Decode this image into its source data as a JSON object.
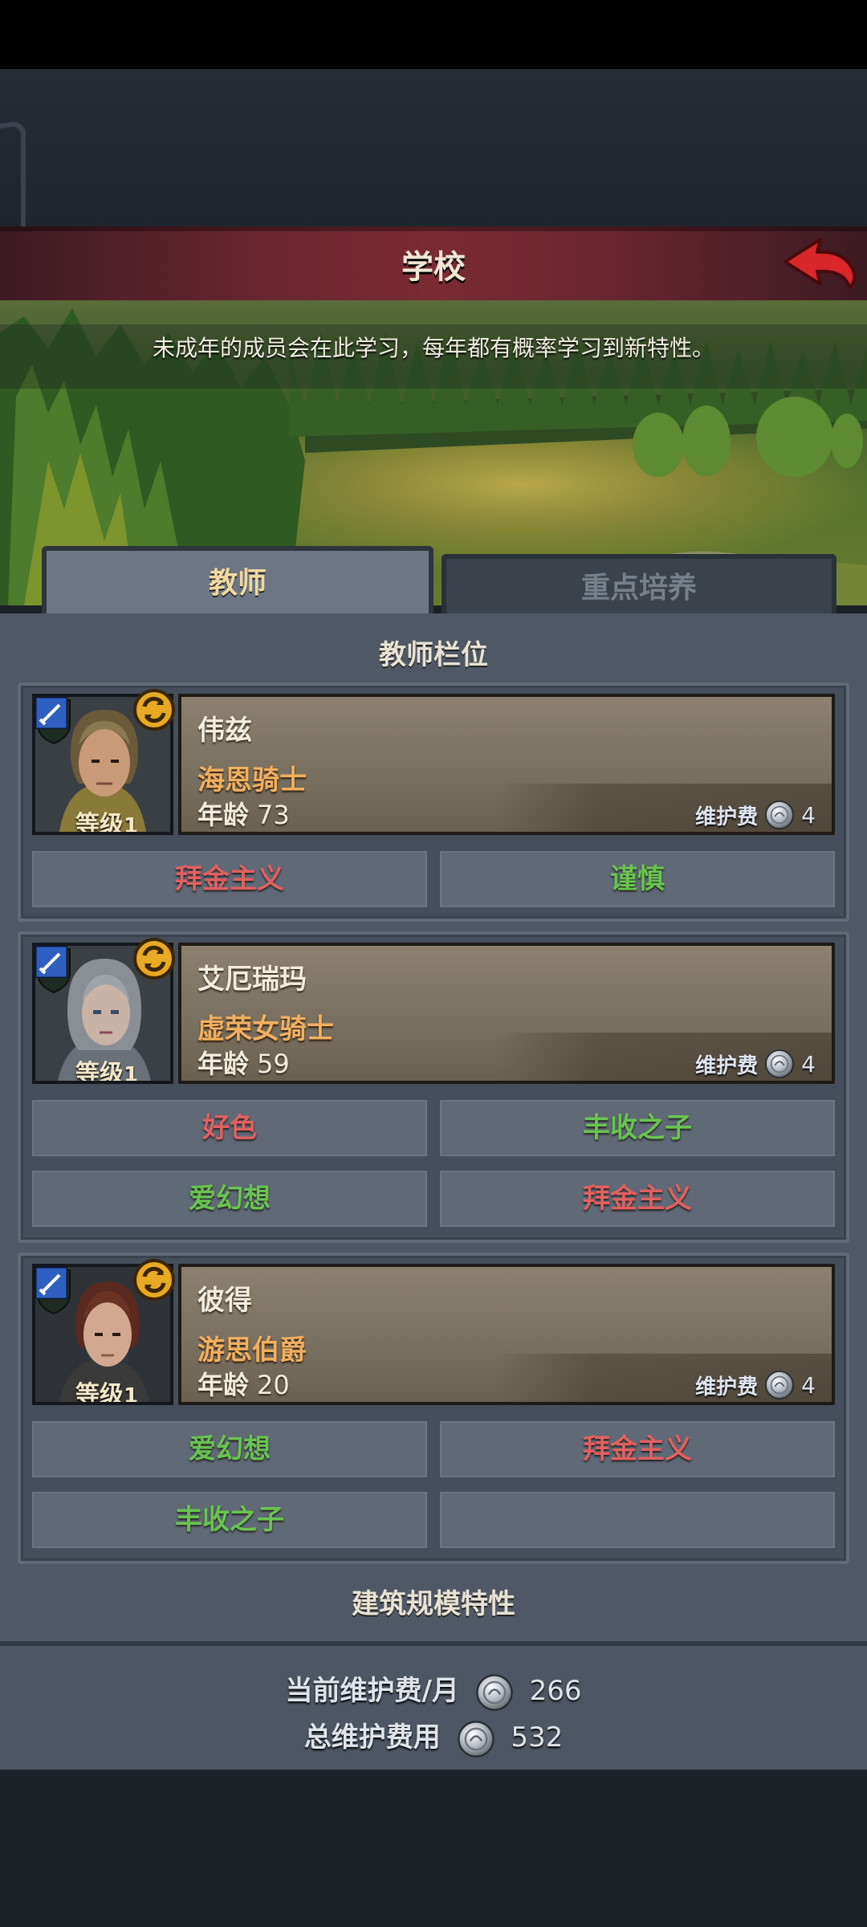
{
  "header": {
    "title": "学校"
  },
  "banner": {
    "description": "未成年的成员会在此学习，每年都有概率学习到新特性。"
  },
  "tabs": [
    {
      "label": "教师",
      "active": true
    },
    {
      "label": "重点培养",
      "active": false
    }
  ],
  "teacher_section": {
    "title": "教师栏位"
  },
  "teachers": [
    {
      "name": "伟兹",
      "title": "海恩骑士",
      "level_label": "等级",
      "level": "1",
      "age_label": "年龄",
      "age": "73",
      "upkeep_label": "维护费",
      "upkeep": "4",
      "traits": [
        {
          "label": "拜金主义",
          "color": "red"
        },
        {
          "label": "谨慎",
          "color": "green"
        }
      ]
    },
    {
      "name": "艾厄瑞玛",
      "title": "虚荣女骑士",
      "level_label": "等级",
      "level": "1",
      "age_label": "年龄",
      "age": "59",
      "upkeep_label": "维护费",
      "upkeep": "4",
      "traits": [
        {
          "label": "好色",
          "color": "red"
        },
        {
          "label": "丰收之子",
          "color": "green"
        },
        {
          "label": "爱幻想",
          "color": "green"
        },
        {
          "label": "拜金主义",
          "color": "red"
        }
      ]
    },
    {
      "name": "彼得",
      "title": "游思伯爵",
      "level_label": "等级",
      "level": "1",
      "age_label": "年龄",
      "age": "20",
      "upkeep_label": "维护费",
      "upkeep": "4",
      "traits": [
        {
          "label": "爱幻想",
          "color": "green"
        },
        {
          "label": "拜金主义",
          "color": "red"
        },
        {
          "label": "丰收之子",
          "color": "green"
        },
        {
          "label": "",
          "color": ""
        }
      ]
    }
  ],
  "building_section": {
    "title": "建筑规模特性"
  },
  "footer": {
    "current_upkeep_label": "当前维护费/月",
    "current_upkeep": "266",
    "total_upkeep_label": "总维护费用",
    "total_upkeep": "532"
  },
  "colors": {
    "trait_red": "#e06060",
    "trait_green": "#69c450",
    "title_orange": "#f0b060",
    "header_red": "#7a2a33"
  }
}
